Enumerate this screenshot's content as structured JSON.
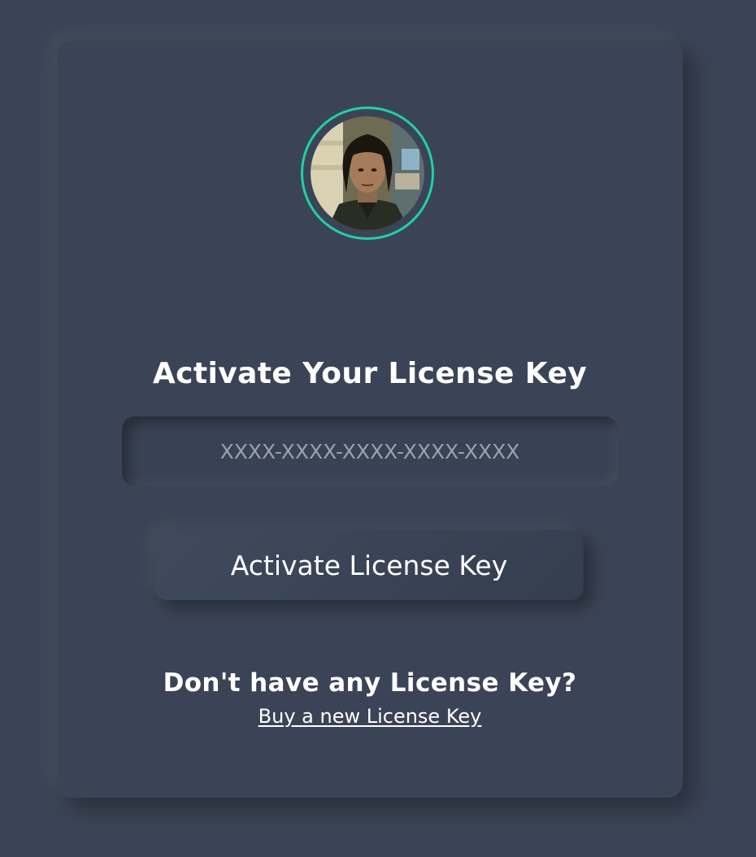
{
  "card": {
    "title": "Activate Your License Key",
    "license_input": {
      "value": "",
      "placeholder": "XXXX-XXXX-XXXX-XXXX-XXXX"
    },
    "activate_button_label": "Activate License Key",
    "no_key_prompt": "Don't have any License Key?",
    "buy_link_label": "Buy a new License Key"
  },
  "colors": {
    "background": "#3b4456",
    "accent_ring": "#1fd1a4",
    "text": "#ffffff",
    "placeholder": "#9aa1ae"
  }
}
